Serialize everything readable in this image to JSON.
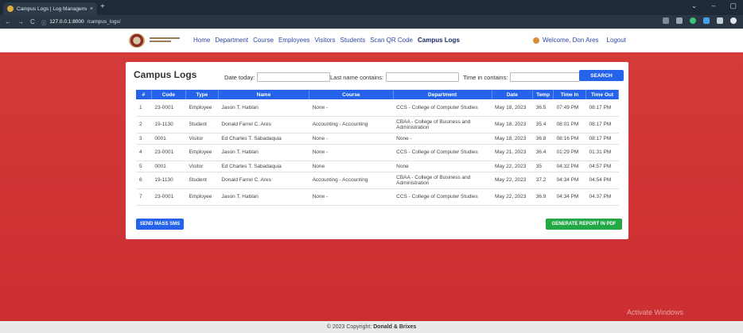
{
  "browser": {
    "tab_title": "Campus Logs | Log Managemen",
    "tab_close": "×",
    "new_tab": "+",
    "url_host": "127.0.0.1:8000",
    "url_path": "/campus_logs/",
    "url_prefix": "ⓘ",
    "win_controls": [
      "⌄",
      "–",
      "▢"
    ]
  },
  "header": {
    "nav": [
      "Home",
      "Department",
      "Course",
      "Employees",
      "Visitors",
      "Students",
      "Scan QR Code",
      "Campus Logs"
    ],
    "active_nav": "Campus Logs",
    "welcome": "Welcome, Don Ares",
    "logout": "Logout"
  },
  "page": {
    "title": "Campus Logs",
    "filters": {
      "date_label": "Date today:",
      "lastname_label": "Last name contains:",
      "time_label": "Time in contains:",
      "search_label": "SEARCH"
    },
    "columns": [
      "#",
      "Code",
      "Type",
      "Name",
      "Course",
      "Department",
      "Date",
      "Temp",
      "Time In",
      "Time Out"
    ],
    "rows": [
      [
        "1",
        "23-0001",
        "Employee",
        "Jason T. Hablan",
        "None -",
        "CCS - College of Computer Studies",
        "May 18, 2023",
        "36.5",
        "07:49 PM",
        "08:17 PM"
      ],
      [
        "2",
        "19-1130",
        "Student",
        "Donald Farrel C. Ares",
        "Accounting - Accounting",
        "CBAA - College of Business and Administration",
        "May 18, 2023",
        "35.4",
        "08:01 PM",
        "08:17 PM"
      ],
      [
        "3",
        "0001",
        "Visitor",
        "Ed Charles T. Sabadaquia",
        "None -",
        "None -",
        "May 18, 2023",
        "36.8",
        "08:16 PM",
        "08:17 PM"
      ],
      [
        "4",
        "23-0001",
        "Employee",
        "Jason T. Hablan",
        "None -",
        "CCS - College of Computer Studies",
        "May 21, 2023",
        "36.4",
        "01:29 PM",
        "01:31 PM"
      ],
      [
        "5",
        "0001",
        "Visitor",
        "Ed Charles T. Sabadaquia",
        "None",
        "None",
        "May 22, 2023",
        "35",
        "04:32 PM",
        "04:57 PM"
      ],
      [
        "6",
        "19-1130",
        "Student",
        "Donald Farrel C. Ares",
        "Accounting - Accounting",
        "CBAA - College of Business and Administration",
        "May 22, 2023",
        "37.2",
        "04:34 PM",
        "04:54 PM"
      ],
      [
        "7",
        "23-0001",
        "Employee",
        "Jason T. Hablan",
        "None -",
        "CCS - College of Computer Studies",
        "May 22, 2023",
        "36.9",
        "04:34 PM",
        "04:37 PM"
      ]
    ],
    "send_sms_label": "SEND MASS SMS",
    "generate_pdf_label": "GENERATE REPORT IN PDF"
  },
  "footer": {
    "text": "© 2023 Copyright: ",
    "brand": "Donald & Brixes"
  },
  "os_watermark": "Activate Windows",
  "colors": {
    "primary": "#2563eb",
    "success": "#22a845",
    "background_red": "#d03535"
  }
}
